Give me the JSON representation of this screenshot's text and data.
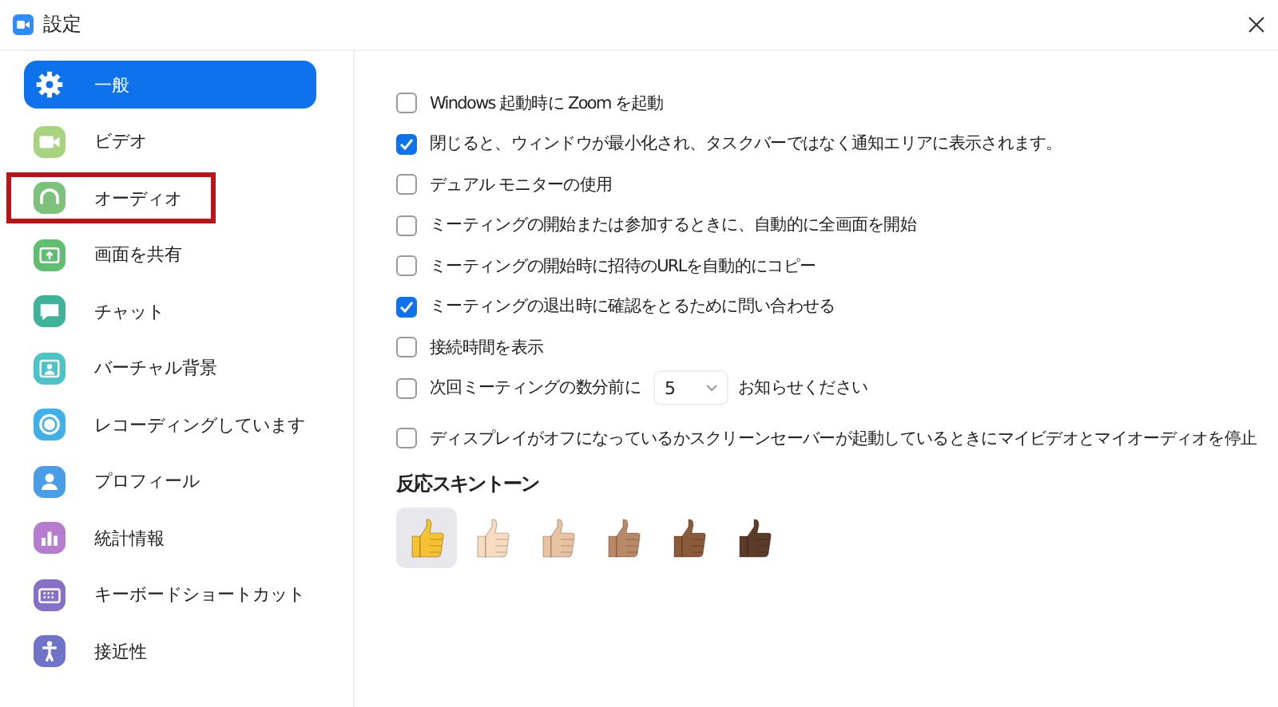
{
  "window": {
    "title": "設定"
  },
  "sidebar": {
    "items": [
      {
        "label": "一般",
        "kind": "gear",
        "color": "#ffffff",
        "selected": true,
        "highlighted": false
      },
      {
        "label": "ビデオ",
        "kind": "video",
        "color": "#a9d47f",
        "selected": false,
        "highlighted": false
      },
      {
        "label": "オーディオ",
        "kind": "headphones",
        "color": "#7cc27a",
        "selected": false,
        "highlighted": true
      },
      {
        "label": "画面を共有",
        "kind": "share",
        "color": "#5fbf6f",
        "selected": false,
        "highlighted": false
      },
      {
        "label": "チャット",
        "kind": "chat",
        "color": "#3fb39a",
        "selected": false,
        "highlighted": false
      },
      {
        "label": "バーチャル背景",
        "kind": "background",
        "color": "#4cc3c9",
        "selected": false,
        "highlighted": false
      },
      {
        "label": "レコーディングしています",
        "kind": "record",
        "color": "#3fb0e8",
        "selected": false,
        "highlighted": false
      },
      {
        "label": "プロフィール",
        "kind": "profile",
        "color": "#4a9ee8",
        "selected": false,
        "highlighted": false
      },
      {
        "label": "統計情報",
        "kind": "stats",
        "color": "#b57ccf",
        "selected": false,
        "highlighted": false
      },
      {
        "label": "キーボードショートカット",
        "kind": "keyboard",
        "color": "#8670c8",
        "selected": false,
        "highlighted": false
      },
      {
        "label": "接近性",
        "kind": "accessibility",
        "color": "#6f74c9",
        "selected": false,
        "highlighted": false
      }
    ]
  },
  "options": [
    {
      "kind": "checkbox",
      "label": "Windows 起動時に Zoom を起動",
      "checked": false
    },
    {
      "kind": "checkbox",
      "label": "閉じると、ウィンドウが最小化され、タスクバーではなく通知エリアに表示されます。",
      "checked": true
    },
    {
      "kind": "checkbox",
      "label": "デュアル モニターの使用",
      "checked": false
    },
    {
      "kind": "checkbox",
      "label": "ミーティングの開始または参加するときに、自動的に全画面を開始",
      "checked": false
    },
    {
      "kind": "checkbox",
      "label": "ミーティングの開始時に招待のURLを自動的にコピー",
      "checked": false
    },
    {
      "kind": "checkbox",
      "label": "ミーティングの退出時に確認をとるために問い合わせる",
      "checked": true
    },
    {
      "kind": "checkbox",
      "label": "接続時間を表示",
      "checked": false
    },
    {
      "kind": "reminder",
      "label": "次回ミーティングの数分前に",
      "value": "5",
      "suffix": "お知らせください",
      "checked": false
    },
    {
      "kind": "checkbox",
      "label": "ディスプレイがオフになっているかスクリーンセーバーが起動しているときにマイビデオとマイオーディオを停止",
      "checked": false
    }
  ],
  "skin_tone": {
    "heading": "反応スキントーン",
    "tones": [
      {
        "color": "#f5c232",
        "selected": true
      },
      {
        "color": "#f7dcc2",
        "selected": false
      },
      {
        "color": "#e9c2a2",
        "selected": false
      },
      {
        "color": "#b98866",
        "selected": false
      },
      {
        "color": "#8b5a3a",
        "selected": false
      },
      {
        "color": "#5b3c2a",
        "selected": false
      }
    ]
  }
}
